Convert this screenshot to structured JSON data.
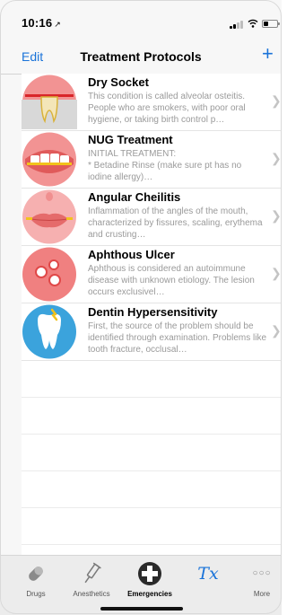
{
  "status": {
    "time": "10:16",
    "location_arrow": "↗"
  },
  "nav": {
    "edit_label": "Edit",
    "title": "Treatment Protocols",
    "add_label": "+"
  },
  "protocols": [
    {
      "title": "Dry Socket",
      "description": "This condition is called alveolar osteitis. People who are smokers, with poor oral hygiene, or taking birth control p…"
    },
    {
      "title": "NUG Treatment",
      "description": "INITIAL TREATMENT:\n * Betadine Rinse (make sure pt has no iodine allergy)…"
    },
    {
      "title": "Angular Cheilitis",
      "description": "Inflammation of the angles of the mouth, characterized by fissures, scaling, erythema and crusting…"
    },
    {
      "title": "Aphthous Ulcer",
      "description": "Aphthous is considered an autoimmune disease with unknown etiology. The lesion occurs exclusivel…"
    },
    {
      "title": "Dentin Hypersensitivity",
      "description": "First, the source of the problem should be identified through examination. Problems like tooth fracture, occlusal…"
    }
  ],
  "tabs": [
    {
      "label": "Drugs",
      "icon": "pill-icon"
    },
    {
      "label": "Anesthetics",
      "icon": "syringe-icon"
    },
    {
      "label": "Emergencies",
      "icon": "medical-cross-icon"
    },
    {
      "label": "",
      "icon": "prescription-tx-icon",
      "glyph": "Tx"
    },
    {
      "label": "More",
      "icon": "more-dots-icon",
      "glyph": "○○○"
    }
  ],
  "colors": {
    "accent": "#1a73d9",
    "thumb_red": "#f08f8f",
    "thumb_blue": "#3ba3dc"
  }
}
